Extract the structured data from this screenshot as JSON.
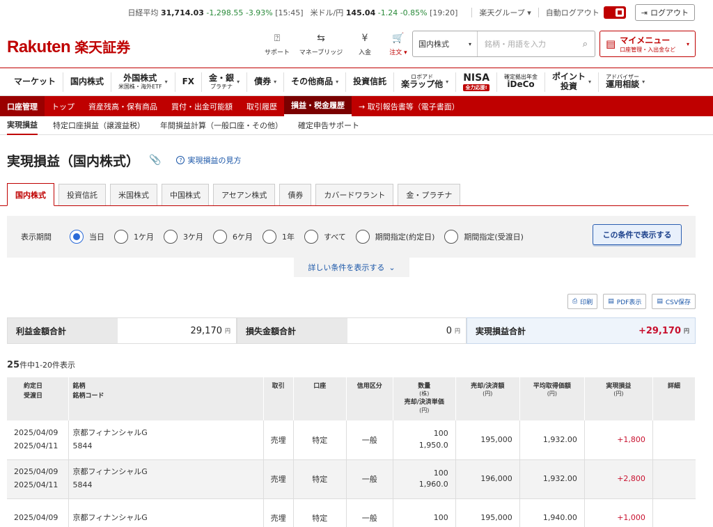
{
  "topbar": {
    "nikkei_label": "日経平均",
    "nikkei_value": "31,714.03",
    "nikkei_change": "-1,298.55",
    "nikkei_pct": "-3.93%",
    "nikkei_time": "[15:45]",
    "usdjpy_label": "米ドル/円",
    "usdjpy_value": "145.04",
    "usdjpy_change": "-1.24",
    "usdjpy_pct": "-0.85%",
    "usdjpy_time": "[19:20]",
    "group_label": "楽天グループ ▾",
    "autologout_label": "自動ログアウト",
    "logout_label": "ログアウト"
  },
  "header": {
    "logo_en": "Rakuten",
    "logo_jp": "楽天証券",
    "icons": [
      {
        "label": "サポート",
        "icon": "support-icon"
      },
      {
        "label": "マネーブリッジ",
        "icon": "bank-icon"
      },
      {
        "label": "入金",
        "icon": "deposit-icon"
      },
      {
        "label": "注文 ▾",
        "icon": "cart-icon"
      }
    ],
    "search_select": "国内株式",
    "search_placeholder": "銘柄・用語を入力",
    "mymenu_title": "マイメニュー",
    "mymenu_sub": "口座管理・入出金など"
  },
  "gnav": [
    {
      "label": "マーケット",
      "sub": ""
    },
    {
      "label": "国内株式",
      "sub": ""
    },
    {
      "label": "外国株式",
      "sub": "米国株・海外ETF"
    },
    {
      "label": "FX",
      "sub": ""
    },
    {
      "label": "金・銀",
      "sub": "プラチナ"
    },
    {
      "label": "債券",
      "sub": ""
    },
    {
      "label": "その他商品",
      "sub": ""
    },
    {
      "label": "投資信託",
      "sub": ""
    },
    {
      "label": "ロボアド",
      "sub": "楽ラップ他"
    },
    {
      "label": "NISA",
      "sub": "全力応援!"
    },
    {
      "label": "確定拠出年金",
      "sub": "iDeCo"
    },
    {
      "label": "ポイント",
      "sub": "投資"
    },
    {
      "label": "アドバイザー",
      "sub": "運用相談"
    }
  ],
  "rednav": [
    "口座管理",
    "トップ",
    "資産残高・保有商品",
    "買付・出金可能額",
    "取引履歴",
    "損益・税金履歴",
    "→ 取引報告書等（電子書面）"
  ],
  "subnav": [
    "実現損益",
    "特定口座損益（譲渡益税）",
    "年間損益計算（一般口座・その他）",
    "確定申告サポート"
  ],
  "page": {
    "title": "実現損益（国内株式）",
    "help_label": "実現損益の見方"
  },
  "tabs": [
    "国内株式",
    "投資信託",
    "米国株式",
    "中国株式",
    "アセアン株式",
    "債券",
    "カバードワラント",
    "金・プラチナ"
  ],
  "filter": {
    "label": "表示期間",
    "options": [
      "当日",
      "1ケ月",
      "3ケ月",
      "6ケ月",
      "1年",
      "すべて",
      "期間指定(約定日)",
      "期間指定(受渡日)"
    ],
    "selected": "当日",
    "show_button": "この条件で表示する",
    "more_label": "詳しい条件を表示する"
  },
  "tools": [
    "印刷",
    "PDF表示",
    "CSV保存"
  ],
  "summary": {
    "profit_label": "利益金額合計",
    "profit_value": "29,170",
    "loss_label": "損失金額合計",
    "loss_value": "0",
    "realized_label": "実現損益合計",
    "realized_value": "+29,170",
    "unit": "円"
  },
  "count": {
    "total": "25",
    "text": "件中1-20件表示"
  },
  "table": {
    "headers": {
      "date1": "約定日",
      "date2": "受渡日",
      "stock1": "銘柄",
      "stock2": "銘柄コード",
      "trade": "取引",
      "account": "口座",
      "credit": "信用区分",
      "qty": "数量",
      "qty_unit": "(株)",
      "price": "売却/決済単価",
      "price_unit": "(円)",
      "amount": "売却/決済額",
      "amount_unit": "(円)",
      "avg": "平均取得価額",
      "avg_unit": "(円)",
      "pl": "実現損益",
      "pl_unit": "(円)",
      "detail": "詳細"
    },
    "rows": [
      {
        "trade_date": "2025/04/09",
        "settle_date": "2025/04/11",
        "name": "京都フィナンシャルG",
        "code": "5844",
        "trade": "売埋",
        "account": "特定",
        "credit": "一般",
        "qty": "100",
        "price": "1,950.0",
        "amount": "195,000",
        "avg": "1,932.00",
        "pl": "+1,800"
      },
      {
        "trade_date": "2025/04/09",
        "settle_date": "2025/04/11",
        "name": "京都フィナンシャルG",
        "code": "5844",
        "trade": "売埋",
        "account": "特定",
        "credit": "一般",
        "qty": "100",
        "price": "1,960.0",
        "amount": "196,000",
        "avg": "1,932.00",
        "pl": "+2,800"
      },
      {
        "trade_date": "2025/04/09",
        "settle_date": "",
        "name": "京都フィナンシャルG",
        "code": "",
        "trade": "売埋",
        "account": "特定",
        "credit": "一般",
        "qty": "100",
        "price": "",
        "amount": "195,000",
        "avg": "1,940.00",
        "pl": "+1,000"
      }
    ]
  },
  "colors": {
    "brand": "#bf0000",
    "positive": "#c8102e",
    "link": "#1a56a8",
    "selected_radio": "#2a6ad8"
  }
}
